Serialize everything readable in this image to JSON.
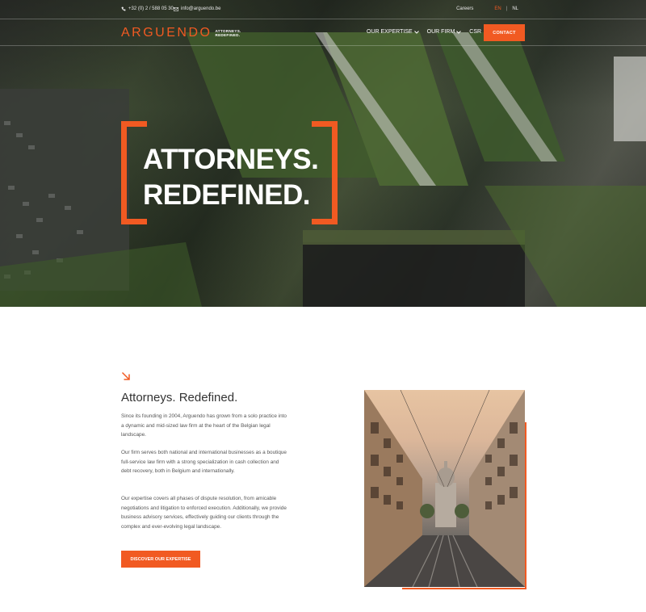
{
  "topbar": {
    "phone": "+32 (0) 2 / 588 05 30",
    "email": "info@arguendo.be",
    "careers": "Careers",
    "lang_en": "EN",
    "lang_sep": "|",
    "lang_nl": "NL"
  },
  "nav": {
    "logo_word": "ARGUENDO",
    "logo_tag_line1": "ATTORNEYS.",
    "logo_tag_line2": "REDEFINED.",
    "items": [
      {
        "label": "OUR EXPERTISE"
      },
      {
        "label": "OUR FIRM"
      },
      {
        "label": "CSR"
      }
    ],
    "contact": "CONTACT"
  },
  "hero": {
    "line1": "ATTORNEYS.",
    "line2": "REDEFINED."
  },
  "about": {
    "title": "Attorneys. Redefined.",
    "p1": "Since its founding in 2004, Arguendo has grown from a solo practice into a dynamic and mid-sized law firm at the heart of the Belgian legal landscape.",
    "p2": "Our firm serves both national and international businesses as a boutique full-service law firm with a strong specialization in cash collection and debt recovery, both in Belgium and internationally.",
    "p3": "Our expertise covers all phases of dispute resolution, from amicable negotiations and litigation to enforced execution. Additionally, we provide business advisory services, effectively guiding our clients through the complex and ever-evolving legal landscape.",
    "button": "DISCOVER OUR EXPERTISE"
  },
  "colors": {
    "accent": "#f15a22"
  },
  "icons": {
    "phone": "phone-icon",
    "email": "envelope-icon",
    "arrow": "arrow-down-right-icon",
    "chevron": "chevron-down-icon"
  }
}
